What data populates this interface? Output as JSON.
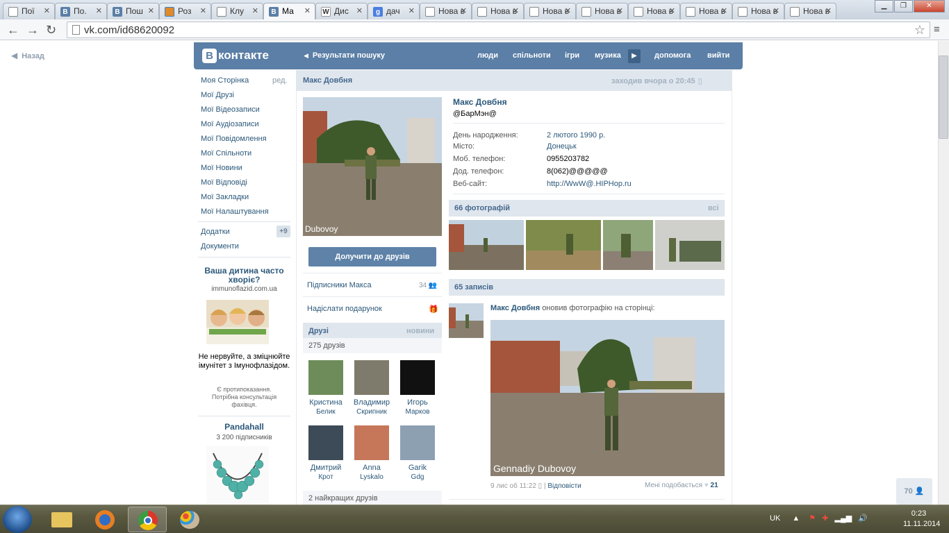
{
  "browser": {
    "tabs": [
      {
        "label": "Пої",
        "icon": "doc"
      },
      {
        "label": "По.",
        "icon": "vk"
      },
      {
        "label": "Пош",
        "icon": "vk"
      },
      {
        "label": "Роз",
        "icon": "win"
      },
      {
        "label": "Клу",
        "icon": "doc"
      },
      {
        "label": "Ма",
        "icon": "vk"
      },
      {
        "label": "Дис",
        "icon": "wiki"
      },
      {
        "label": "дач",
        "icon": "google"
      },
      {
        "label": "Нова в",
        "icon": "doc"
      },
      {
        "label": "Нова в",
        "icon": "doc"
      },
      {
        "label": "Нова в",
        "icon": "doc"
      },
      {
        "label": "Нова в",
        "icon": "doc"
      },
      {
        "label": "Нова в",
        "icon": "doc"
      },
      {
        "label": "Нова в",
        "icon": "doc"
      },
      {
        "label": "Нова в",
        "icon": "doc"
      },
      {
        "label": "Нова в",
        "icon": "doc"
      }
    ],
    "url": "vk.com/id68620092"
  },
  "back": "Назад",
  "header": {
    "logo": "контакте",
    "logo_b": "B",
    "search_results": "Результати пошуку",
    "nav": [
      "люди",
      "спільноти",
      "ігри",
      "музика",
      "допомога",
      "вийти"
    ]
  },
  "left_menu": {
    "items": [
      "Моя Сторінка",
      "Мої Друзі",
      "Мої Відеозаписи",
      "Мої Аудіозаписи",
      "Мої Повідомлення",
      "Мої Спільноти",
      "Мої Новини",
      "Мої Відповіді",
      "Мої Закладки",
      "Мої Налаштування"
    ],
    "edit": "ред.",
    "apps": "Додатки",
    "apps_badge": "+9",
    "docs": "Документи"
  },
  "ad1": {
    "title": "Ваша дитина часто хворіє?",
    "domain": "immunoflazid.com.ua",
    "text": "Не нервуйте, а зміцнюйте імунітет з Імунофлазідом.",
    "note": "Є протипоказання. Потрібна консультація фахівця."
  },
  "ad2": {
    "title": "Pandahall",
    "subs": "3 200 підписників"
  },
  "profile": {
    "title": "Макс Довбня",
    "online": "заходив вчора о 20:45",
    "photo_caption": "Dubovoy",
    "add_friend": "Долучити до друзів",
    "subscribers": "Підписники Макса",
    "subscribers_count": "34",
    "gift": "Надіслати подарунок",
    "friends_title": "Друзі",
    "friends_new": "новини",
    "friends_count": "275 друзів",
    "friends": [
      {
        "first": "Кристина",
        "last": "Белик"
      },
      {
        "first": "Владимир",
        "last": "Скрипник"
      },
      {
        "first": "Игорь",
        "last": "Марков"
      },
      {
        "first": "Дмитрий",
        "last": "Крот"
      },
      {
        "first": "Anna",
        "last": "Lyskalo"
      },
      {
        "first": "Garik",
        "last": "Gdg"
      }
    ],
    "best_friends": "2 найкращих друзів",
    "name": "Макс Довбня",
    "status": "@БарМэн@",
    "info": [
      {
        "label": "День народження:",
        "value": "2 лютого 1990 р."
      },
      {
        "label": "Місто:",
        "value": "Донецьк"
      },
      {
        "label": "Моб. телефон:",
        "value": "0955203782"
      },
      {
        "label": "Дод. телефон:",
        "value": "8(062)@@@@@"
      },
      {
        "label": "Веб-сайт:",
        "value": "http://WwW@.HIPHop.ru"
      }
    ],
    "photos_title": "66 фотографій",
    "photos_all": "всі",
    "posts_title": "65 записів",
    "post": {
      "author": "Макс Довбня",
      "action": "оновив фотографію на сторінці:",
      "caption": "Gennadiy Dubovoy",
      "date": "9 лис об 11:22",
      "replies": "Відповісти",
      "likes_label": "Мені подобається",
      "likes": "21"
    },
    "side_counter": "70"
  },
  "taskbar": {
    "lang": "UK",
    "time": "0:23",
    "date": "11.11.2014"
  }
}
